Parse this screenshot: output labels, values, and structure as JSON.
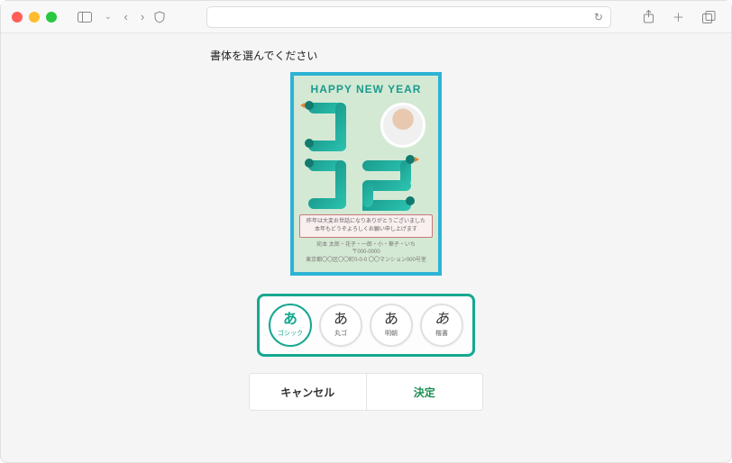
{
  "instruction": "書体を選んでください",
  "card": {
    "title": "HAPPY NEW YEAR",
    "message_line1": "昨年は大変お世話になりありがとうございました",
    "message_line2": "本年もどうぞよろしくお願い申し上げます",
    "addr_line1": "宛本 太郎・花子・一郎・小・華子・いち",
    "addr_line2": "〒000-0000",
    "addr_line3": "東京都〇〇区〇〇町0-0-0 〇〇マンション000号室"
  },
  "font_options": [
    {
      "glyph": "あ",
      "label": "ゴシック",
      "selected": true
    },
    {
      "glyph": "あ",
      "label": "丸ゴ",
      "selected": false
    },
    {
      "glyph": "あ",
      "label": "明朝",
      "selected": false
    },
    {
      "glyph": "あ",
      "label": "楷書",
      "selected": false
    }
  ],
  "buttons": {
    "cancel": "キャンセル",
    "confirm": "決定"
  }
}
